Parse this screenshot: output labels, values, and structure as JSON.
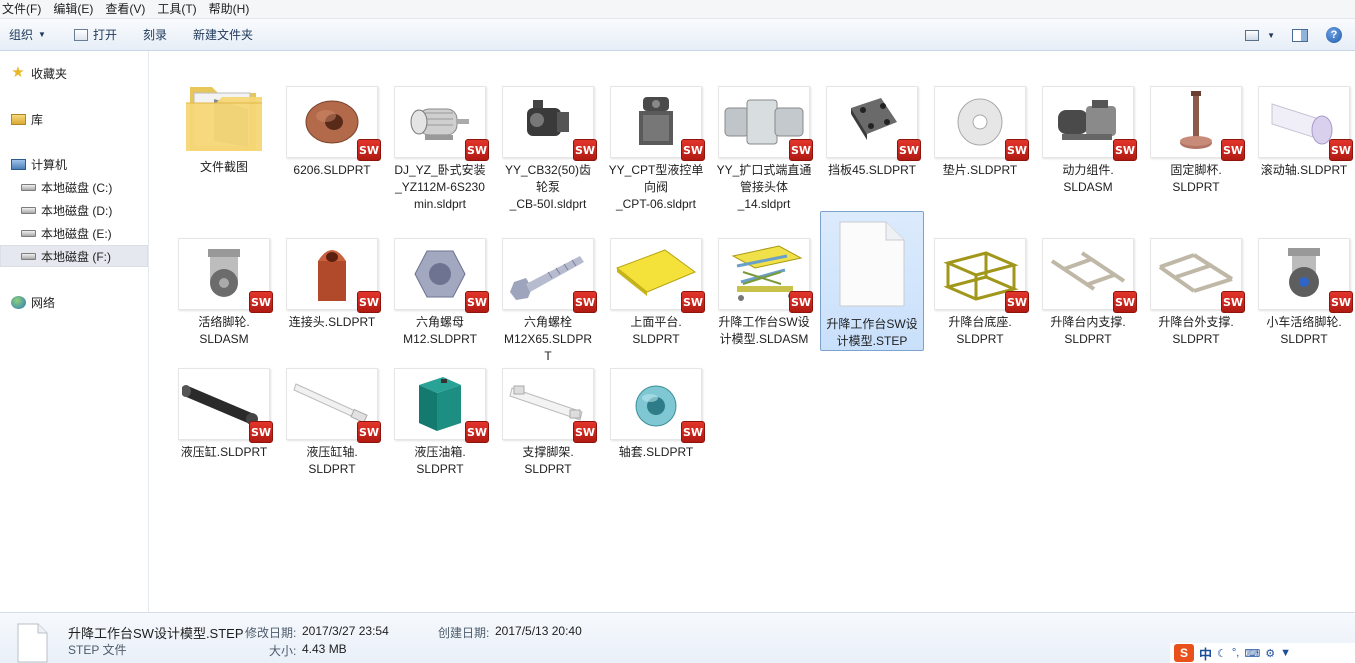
{
  "menu": [
    "文件(F)",
    "编辑(E)",
    "查看(V)",
    "工具(T)",
    "帮助(H)"
  ],
  "toolbar": {
    "organize": "组织",
    "open": "打开",
    "burn": "刻录",
    "new_folder": "新建文件夹"
  },
  "nav": {
    "favorites": "收藏夹",
    "library": "库",
    "computer": "计算机",
    "drives": [
      "本地磁盘 (C:)",
      "本地磁盘 (D:)",
      "本地磁盘 (E:)",
      "本地磁盘 (F:)"
    ],
    "network": "网络"
  },
  "files": [
    {
      "name": "文件截图",
      "kind": "folder"
    },
    {
      "name": "6206.SLDPRT",
      "kind": "bearing"
    },
    {
      "name": "DJ_YZ_卧式安装_YZ112M-6S230min.sldprt",
      "kind": "motor"
    },
    {
      "name": "YY_CB32(50)齿轮泵_CB-50I.sldprt",
      "kind": "pump"
    },
    {
      "name": "YY_CPT型液控单向阀_CPT-06.sldprt",
      "kind": "valve"
    },
    {
      "name": "YY_扩口式端直通管接头体_14.sldprt",
      "kind": "fitting"
    },
    {
      "name": "挡板45.SLDPRT",
      "kind": "plate"
    },
    {
      "name": "垫片.SLDPRT",
      "kind": "washer"
    },
    {
      "name": "动力组件.SLDASM",
      "kind": "power"
    },
    {
      "name": "固定脚杯.SLDPRT",
      "kind": "foot"
    },
    {
      "name": "滚动轴.SLDPRT",
      "kind": "roller"
    },
    {
      "name": "活络脚轮.SLDASM",
      "kind": "caster"
    },
    {
      "name": "连接头.SLDPRT",
      "kind": "clevis"
    },
    {
      "name": "六角螺母M12.SLDPRT",
      "kind": "nut"
    },
    {
      "name": "六角螺栓M12X65.SLDPRT",
      "kind": "bolt"
    },
    {
      "name": "上面平台.SLDPRT",
      "kind": "platform"
    },
    {
      "name": "升降工作台SW设计模型.SLDASM",
      "kind": "lifttable"
    },
    {
      "name": "升降工作台SW设计模型.STEP",
      "kind": "step"
    },
    {
      "name": "升降台底座.SLDPRT",
      "kind": "base"
    },
    {
      "name": "升降台内支撑.SLDPRT",
      "kind": "inner"
    },
    {
      "name": "升降台外支撑.SLDPRT",
      "kind": "outer"
    },
    {
      "name": "小车活络脚轮.SLDPRT",
      "kind": "caster2"
    },
    {
      "name": "液压缸.SLDPRT",
      "kind": "cylinder"
    },
    {
      "name": "液压缸轴.SLDPRT",
      "kind": "rod"
    },
    {
      "name": "液压油箱.SLDPRT",
      "kind": "tank"
    },
    {
      "name": "支撑脚架.SLDPRT",
      "kind": "bracket"
    },
    {
      "name": "轴套.SLDPRT",
      "kind": "sleeve"
    }
  ],
  "labels": [
    [
      "文件截图"
    ],
    [
      "6206.SLDPRT"
    ],
    [
      "DJ_YZ_卧式安装",
      "_YZ112M-6S230",
      "min.sldprt"
    ],
    [
      "YY_CB32(50)齿",
      "轮泵",
      "_CB-50I.sldprt"
    ],
    [
      "YY_CPT型液控单",
      "向阀",
      "_CPT-06.sldprt"
    ],
    [
      "YY_扩口式端直通",
      "管接头体",
      "_14.sldprt"
    ],
    [
      "挡板45.SLDPRT"
    ],
    [
      "垫片.SLDPRT"
    ],
    [
      "动力组件.",
      "SLDASM"
    ],
    [
      "固定脚杯.",
      "SLDPRT"
    ],
    [
      "滚动轴.SLDPRT"
    ],
    [
      "活络脚轮.",
      "SLDASM"
    ],
    [
      "连接头.SLDPRT"
    ],
    [
      "六角螺母",
      "M12.SLDPRT"
    ],
    [
      "六角螺栓",
      "M12X65.SLDPR",
      "T"
    ],
    [
      "上面平台.",
      "SLDPRT"
    ],
    [
      "升降工作台SW设",
      "计模型.SLDASM"
    ],
    [
      "升降工作台SW设",
      "计模型.STEP"
    ],
    [
      "升降台底座.",
      "SLDPRT"
    ],
    [
      "升降台内支撑.",
      "SLDPRT"
    ],
    [
      "升降台外支撑.",
      "SLDPRT"
    ],
    [
      "小车活络脚轮.",
      "SLDPRT"
    ],
    [
      "液压缸.SLDPRT"
    ],
    [
      "液压缸轴.",
      "SLDPRT"
    ],
    [
      "液压油箱.",
      "SLDPRT"
    ],
    [
      "支撑脚架.",
      "SLDPRT"
    ],
    [
      "轴套.SLDPRT"
    ]
  ],
  "selected_index": 17,
  "badge_text": "SW",
  "details": {
    "name": "升降工作台SW设计模型.STEP",
    "type": "STEP 文件",
    "modified_label": "修改日期:",
    "modified": "2017/3/27 23:54",
    "created_label": "创建日期:",
    "created": "2017/5/13 20:40",
    "size_label": "大小:",
    "size": "4.43 MB"
  },
  "ime": {
    "logo": "S",
    "lang": "中"
  },
  "colors": {
    "accent": "#1e395b",
    "sw_badge": "#d42a20",
    "selection": "#cde4fb"
  }
}
